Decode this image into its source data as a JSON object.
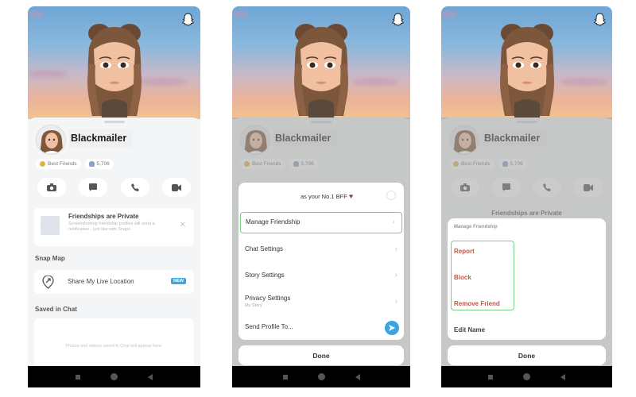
{
  "profile": {
    "name": "Blackmailer",
    "chips": {
      "best_friends": "Best Friends",
      "score": "5,706"
    }
  },
  "panel1": {
    "notice": {
      "title": "Friendships are Private",
      "text": "Screenshotting friendship profiles will send a notification - just like with Snaps."
    },
    "snap_map": {
      "section": "Snap Map",
      "share_label": "Share My Live Location",
      "badge": "NEW"
    },
    "saved": {
      "section": "Saved in Chat",
      "empty_text": "Photos and videos saved in Chat will appear here."
    }
  },
  "panel2": {
    "bff_text": "as your No.1 BFF",
    "bff_emoji": "♥",
    "items": [
      {
        "label": "Manage Friendship"
      },
      {
        "label": "Chat Settings"
      },
      {
        "label": "Story Settings"
      },
      {
        "label": "Privacy Settings",
        "sub": "My Story"
      },
      {
        "label": "Send Profile To..."
      }
    ],
    "done": "Done"
  },
  "panel3": {
    "header": "Manage Friendship",
    "items": [
      {
        "label": "Report"
      },
      {
        "label": "Block"
      },
      {
        "label": "Remove Friend"
      },
      {
        "label": "Edit Name"
      }
    ],
    "peek_text": "Friendships are Private",
    "done": "Done"
  },
  "colors": {
    "highlight": "#7bd081",
    "accent": "#3aa4e0",
    "danger": "#c05a45"
  }
}
